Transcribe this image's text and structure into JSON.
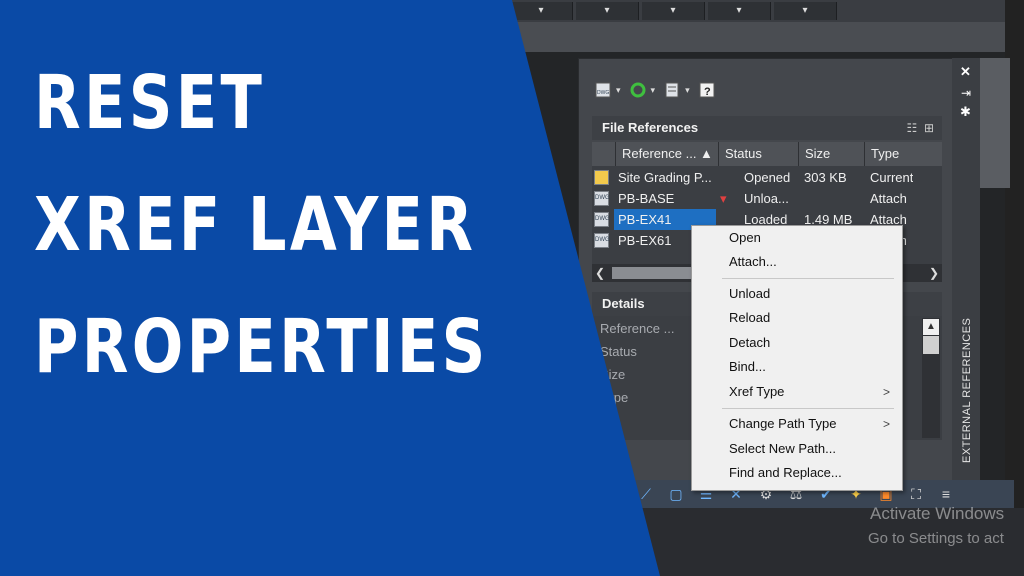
{
  "thumbnail": {
    "title_lines": [
      "RESET",
      "XREF LAYER",
      "PROPERTIES"
    ],
    "background_color": "#0a4aa6"
  },
  "palette": {
    "vertical_title": "EXTERNAL REFERENCES",
    "file_references_label": "File References",
    "details_label": "Details",
    "columns": [
      "Reference ...",
      "Status",
      "Size",
      "Type"
    ],
    "rows": [
      {
        "name": "Site Grading P...",
        "status": "Opened",
        "size": "303 KB",
        "type": "Current"
      },
      {
        "name": "PB-BASE",
        "status": "Unloa...",
        "size": "",
        "type": "Attach"
      },
      {
        "name": "PB-EX41",
        "status": "Loaded",
        "size": "1.49 MB",
        "type": "Attach"
      },
      {
        "name": "PB-EX61",
        "status": "",
        "size": "",
        "type": "Attach"
      }
    ],
    "details_rows": [
      "Reference ...",
      "Status",
      "Size",
      "Type"
    ]
  },
  "context_menu": {
    "items": [
      {
        "label": "Open",
        "submenu": false
      },
      {
        "label": "Attach...",
        "submenu": false
      },
      {
        "label": "Unload",
        "submenu": false
      },
      {
        "label": "Reload",
        "submenu": false
      },
      {
        "label": "Detach",
        "submenu": false
      },
      {
        "label": "Bind...",
        "submenu": false
      },
      {
        "label": "Xref Type",
        "submenu": true
      },
      {
        "label": "Change Path Type",
        "submenu": true
      },
      {
        "label": "Select New Path...",
        "submenu": false
      },
      {
        "label": "Find and Replace...",
        "submenu": false
      }
    ],
    "submenu_arrow": ">"
  },
  "watermark": {
    "line1": "Activate Windows",
    "line2": "Go to Settings to act"
  },
  "icons": [
    "dwg-attach-icon",
    "refresh-icon",
    "change-path-icon",
    "help-icon",
    "close-icon",
    "auto-hide-icon",
    "properties-icon",
    "tree-view-icon",
    "list-view-icon"
  ]
}
